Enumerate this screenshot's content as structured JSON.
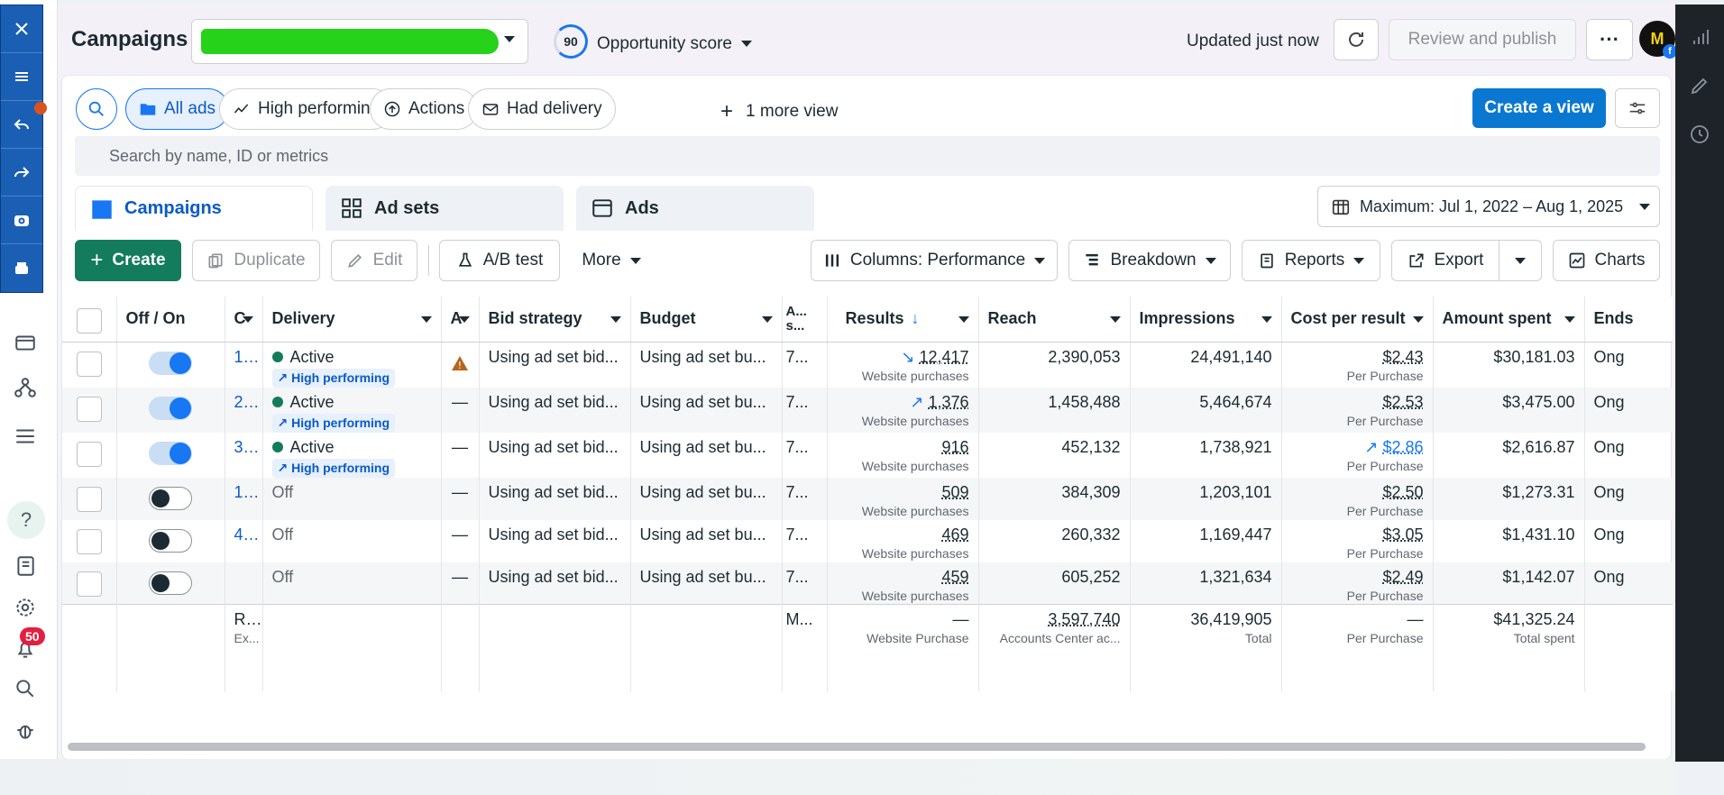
{
  "header": {
    "title": "Campaigns",
    "opportunity_score": "90",
    "opportunity_label": "Opportunity score",
    "updated_text": "Updated just now",
    "review_label": "Review and publish",
    "more_label": "···",
    "brand_initial": "M"
  },
  "views": {
    "pills": [
      "All ads",
      "High performing",
      "Actions",
      "Had delivery"
    ],
    "more_view": "1 more view",
    "create_view": "Create a view"
  },
  "search": {
    "placeholder": "Search by name, ID or metrics"
  },
  "tabs": [
    "Campaigns",
    "Ad sets",
    "Ads"
  ],
  "date_range": "Maximum: Jul 1, 2022 – Aug 1, 2025",
  "toolbar": {
    "create": "Create",
    "duplicate": "Duplicate",
    "edit": "Edit",
    "ab_test": "A/B test",
    "more": "More",
    "columns": "Columns: Performance",
    "breakdown": "Breakdown",
    "reports": "Reports",
    "export": "Export",
    "charts": "Charts"
  },
  "table": {
    "columns": [
      "Off / On",
      "C",
      "Delivery",
      "A",
      "Bid strategy",
      "Budget",
      "A... s...",
      "Results",
      "Reach",
      "Impressions",
      "Cost per result",
      "Amount spent",
      "Ends"
    ],
    "rows": [
      {
        "name": "1...",
        "delivery": "Active",
        "badge": "High performing",
        "attr": "warn",
        "bid": "Using ad set bid...",
        "budget": "Using ad set bu...",
        "as": "7...",
        "results": "12,417",
        "results_trend": "down",
        "results_sub": "Website purchases",
        "reach": "2,390,053",
        "impressions": "24,491,140",
        "cpr": "$2.43",
        "cpr_trend": "",
        "cpr_sub": "Per Purchase",
        "spent": "$30,181.03",
        "ends": "Ong"
      },
      {
        "name": "2...",
        "delivery": "Active",
        "badge": "High performing",
        "attr": "—",
        "bid": "Using ad set bid...",
        "budget": "Using ad set bu...",
        "as": "7...",
        "results": "1,376",
        "results_trend": "up",
        "results_sub": "Website purchases",
        "reach": "1,458,488",
        "impressions": "5,464,674",
        "cpr": "$2.53",
        "cpr_trend": "",
        "cpr_sub": "Per Purchase",
        "spent": "$3,475.00",
        "ends": "Ong"
      },
      {
        "name": "3...",
        "delivery": "Active",
        "badge": "High performing",
        "attr": "—",
        "bid": "Using ad set bid...",
        "budget": "Using ad set bu...",
        "as": "7...",
        "results": "916",
        "results_trend": "",
        "results_sub": "Website purchases",
        "reach": "452,132",
        "impressions": "1,738,921",
        "cpr": "$2.86",
        "cpr_trend": "up",
        "cpr_sub": "Per Purchase",
        "spent": "$2,616.87",
        "ends": "Ong"
      },
      {
        "name": "1...",
        "delivery": "Off",
        "badge": "",
        "attr": "—",
        "bid": "Using ad set bid...",
        "budget": "Using ad set bu...",
        "as": "7...",
        "results": "509",
        "results_trend": "",
        "results_sub": "Website purchases",
        "reach": "384,309",
        "impressions": "1,203,101",
        "cpr": "$2.50",
        "cpr_trend": "",
        "cpr_sub": "Per Purchase",
        "spent": "$1,273.31",
        "ends": "Ong"
      },
      {
        "name": "4...",
        "delivery": "Off",
        "badge": "",
        "attr": "—",
        "bid": "Using ad set bid...",
        "budget": "Using ad set bu...",
        "as": "7...",
        "results": "469",
        "results_trend": "",
        "results_sub": "Website purchases",
        "reach": "260,332",
        "impressions": "1,169,447",
        "cpr": "$3.05",
        "cpr_trend": "",
        "cpr_sub": "Per Purchase",
        "spent": "$1,431.10",
        "ends": "Ong"
      },
      {
        "name": "",
        "delivery": "Off",
        "badge": "",
        "attr": "—",
        "bid": "Using ad set bid...",
        "budget": "Using ad set bu...",
        "as": "7...",
        "results": "459",
        "results_trend": "",
        "results_sub": "Website purchases",
        "reach": "605,252",
        "impressions": "1,321,634",
        "cpr": "$2.49",
        "cpr_trend": "",
        "cpr_sub": "Per Purchase",
        "spent": "$1,142.07",
        "ends": "Ong"
      }
    ],
    "summary": {
      "name": "Res",
      "name_sub": "Ex...",
      "as": "M...",
      "results": "—",
      "results_sub": "Website Purchase",
      "reach": "3,597,740",
      "reach_sub": "Accounts Center ac...",
      "impressions": "36,419,905",
      "impressions_sub": "Total",
      "cpr": "—",
      "cpr_sub": "Per Purchase",
      "spent": "$41,325.24",
      "spent_sub": "Total spent"
    }
  },
  "notifications_count": "50",
  "colors": {
    "primary": "#1877f2",
    "create_green": "#127c5d",
    "active_dot": "#127c5d",
    "overlay_blue": "#1a5fb4"
  }
}
